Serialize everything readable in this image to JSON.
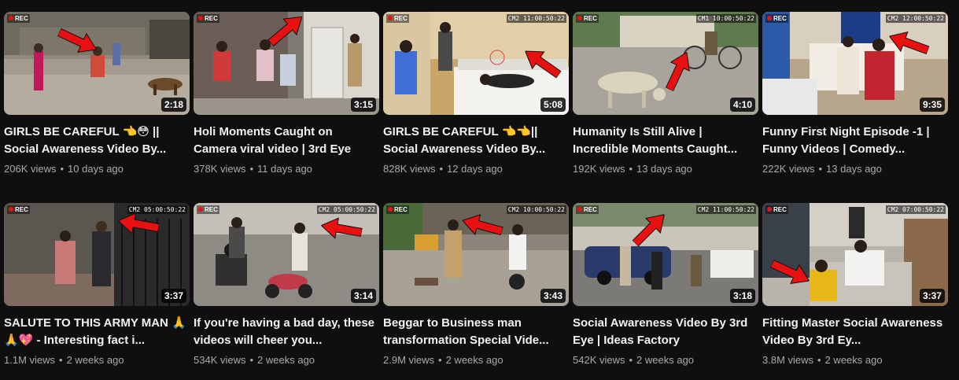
{
  "colors": {
    "background": "#0f0f0f",
    "title": "#f1f1f1",
    "meta": "#aaaaaa",
    "arrow": "#e81010",
    "rec_dot": "#e11111"
  },
  "videos": [
    {
      "title": "GIRLS BE CAREFUL 👈😳 || Social Awareness Video By...",
      "views": "206K views",
      "age": "10 days ago",
      "duration": "2:18",
      "rec_label": "REC",
      "cam_label": "",
      "arrow_icon": "red-arrow-icon",
      "scene": "street-dog"
    },
    {
      "title": "Holi Moments Caught on Camera viral video | 3rd Eye",
      "views": "378K views",
      "age": "11 days ago",
      "duration": "3:15",
      "rec_label": "REC",
      "cam_label": "",
      "arrow_icon": "red-arrow-icon",
      "scene": "holi-gate"
    },
    {
      "title": "GIRLS BE CAREFUL 👈👈|| Social Awareness Video By...",
      "views": "828K views",
      "age": "12 days ago",
      "duration": "5:08",
      "rec_label": "REC",
      "cam_label": "CM2 11:00:50:22",
      "arrow_icon": "red-arrow-icon",
      "scene": "hotel-room"
    },
    {
      "title": "Humanity Is Still Alive | Incredible Moments Caught...",
      "views": "192K views",
      "age": "13 days ago",
      "duration": "4:10",
      "rec_label": "REC",
      "cam_label": "CM1 10:00:50:22",
      "arrow_icon": "red-arrow-icon",
      "scene": "street-dog-cyclist"
    },
    {
      "title": "Funny First Night Episode -1 | Funny Videos | Comedy...",
      "views": "222K views",
      "age": "13 days ago",
      "duration": "9:35",
      "rec_label": "REC",
      "cam_label": "CM2 12:00:50:22",
      "arrow_icon": "red-arrow-icon",
      "scene": "bedroom"
    },
    {
      "title": "SALUTE TO THIS ARMY MAN 🙏🙏💖 - Interesting fact i...",
      "views": "1.1M views",
      "age": "2 weeks ago",
      "duration": "3:37",
      "rec_label": "REC",
      "cam_label": "CM2 05:00:50:22",
      "arrow_icon": "red-arrow-icon",
      "scene": "army-gate"
    },
    {
      "title": "If you're having a bad day, these videos will cheer you...",
      "views": "534K views",
      "age": "2 weeks ago",
      "duration": "3:14",
      "rec_label": "REC",
      "cam_label": "CM2 05:00:50:22",
      "arrow_icon": "red-arrow-icon",
      "scene": "scooter-road"
    },
    {
      "title": "Beggar to Business man transformation Special Vide...",
      "views": "2.9M views",
      "age": "2 weeks ago",
      "duration": "3:43",
      "rec_label": "REC",
      "cam_label": "CM2 10:00:50:22",
      "arrow_icon": "red-arrow-icon",
      "scene": "market-road"
    },
    {
      "title": "Social Awareness Video By 3rd Eye | Ideas Factory",
      "views": "542K views",
      "age": "2 weeks ago",
      "duration": "3:18",
      "rec_label": "REC",
      "cam_label": "CM2 11:00:50:22",
      "arrow_icon": "red-arrow-icon",
      "scene": "car-street"
    },
    {
      "title": "Fitting Master Social Awareness Video By 3rd Ey...",
      "views": "3.8M views",
      "age": "2 weeks ago",
      "duration": "3:37",
      "rec_label": "REC",
      "cam_label": "CM2 07:00:50:22",
      "arrow_icon": "red-arrow-icon",
      "scene": "tailor-shop"
    }
  ]
}
